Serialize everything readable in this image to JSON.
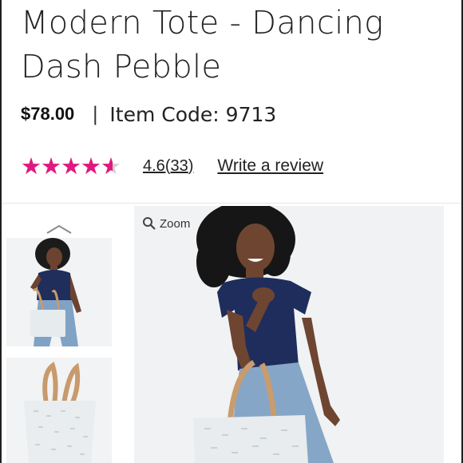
{
  "product": {
    "title": "Modern Tote - Dancing Dash Pebble",
    "price": "$78.00",
    "separator": "|",
    "item_code_label": "Item Code:",
    "item_code": "9713"
  },
  "rating": {
    "stars_glyphs": "★★★★★",
    "value": "4.6",
    "max": 5,
    "count": "33",
    "write_review_label": "Write a review",
    "star_color": "#e0187f"
  },
  "gallery": {
    "zoom_label": "Zoom",
    "thumbnails": [
      "woman-with-tote",
      "tote-bag"
    ],
    "icons": [
      "chevron-up-icon",
      "zoom-magnifier-icon"
    ]
  }
}
